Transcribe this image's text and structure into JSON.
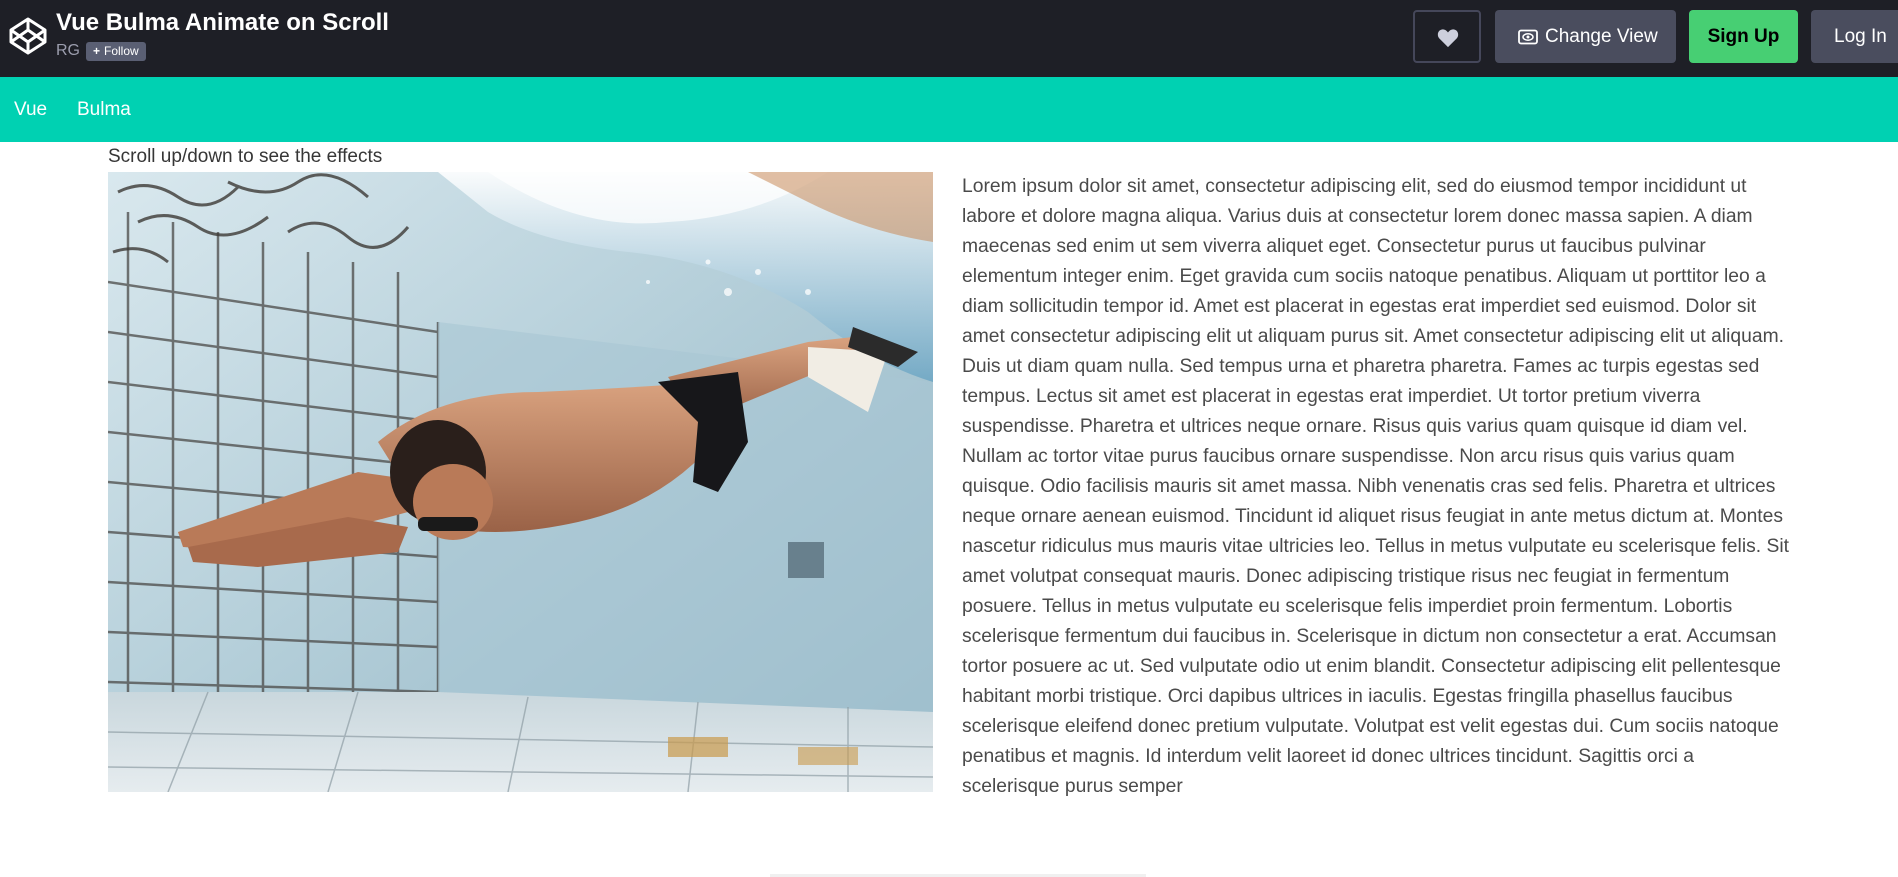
{
  "codepen_header": {
    "title": "Vue Bulma Animate on Scroll",
    "author": "RG",
    "follow_label": "Follow",
    "follow_icon": "plus-icon",
    "heart_icon": "heart-icon",
    "change_view_label": "Change View",
    "change_view_icon": "eye-icon",
    "sign_up_label": "Sign Up",
    "log_in_label": "Log In",
    "colors": {
      "header_bg": "#1e1f26",
      "sign_up_bg": "#47cf73",
      "button_bg": "#4a4d5e"
    }
  },
  "navbar": {
    "bg_color": "#00d1b2",
    "items": [
      {
        "label": "Vue"
      },
      {
        "label": "Bulma"
      }
    ]
  },
  "content": {
    "hint": "Scroll up/down to see the effects",
    "image_subject": "underwater swimmer in pool",
    "paragraph": "Lorem ipsum dolor sit amet, consectetur adipiscing elit, sed do eiusmod tempor incididunt ut labore et dolore magna aliqua. Varius duis at consectetur lorem donec massa sapien. A diam maecenas sed enim ut sem viverra aliquet eget. Consectetur purus ut faucibus pulvinar elementum integer enim. Eget gravida cum sociis natoque penatibus. Aliquam ut porttitor leo a diam sollicitudin tempor id. Amet est placerat in egestas erat imperdiet sed euismod. Dolor sit amet consectetur adipiscing elit ut aliquam purus sit. Amet consectetur adipiscing elit ut aliquam. Duis ut diam quam nulla. Sed tempus urna et pharetra pharetra. Fames ac turpis egestas sed tempus. Lectus sit amet est placerat in egestas erat imperdiet. Ut tortor pretium viverra suspendisse. Pharetra et ultrices neque ornare. Risus quis varius quam quisque id diam vel. Nullam ac tortor vitae purus faucibus ornare suspendisse. Non arcu risus quis varius quam quisque. Odio facilisis mauris sit amet massa. Nibh venenatis cras sed felis. Pharetra et ultrices neque ornare aenean euismod. Tincidunt id aliquet risus feugiat in ante metus dictum at. Montes nascetur ridiculus mus mauris vitae ultricies leo. Tellus in metus vulputate eu scelerisque felis. Sit amet volutpat consequat mauris. Donec adipiscing tristique risus nec feugiat in fermentum posuere. Tellus in metus vulputate eu scelerisque felis imperdiet proin fermentum. Lobortis scelerisque fermentum dui faucibus in. Scelerisque in dictum non consectetur a erat. Accumsan tortor posuere ac ut. Sed vulputate odio ut enim blandit. Consectetur adipiscing elit pellentesque habitant morbi tristique. Orci dapibus ultrices in iaculis. Egestas fringilla phasellus faucibus scelerisque eleifend donec pretium vulputate. Volutpat est velit egestas dui. Cum sociis natoque penatibus et magnis. Id interdum velit laoreet id donec ultrices tincidunt. Sagittis orci a scelerisque purus semper"
  }
}
